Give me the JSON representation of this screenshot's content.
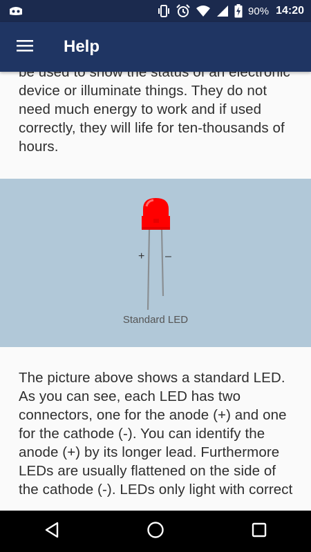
{
  "status_bar": {
    "battery_percent": "90%",
    "time": "14:20",
    "icons": [
      "android-debug-icon",
      "vibrate-icon",
      "alarm-icon",
      "wifi-icon",
      "signal-icon",
      "battery-charging-icon"
    ]
  },
  "app_bar": {
    "title": "Help",
    "menu_icon": "hamburger-menu-icon"
  },
  "content": {
    "paragraph_top": "be used to show the status of an electronic device or illuminate things. They do not need much energy to work and if used correctly, they will life for ten-thousands of hours.",
    "figure": {
      "plus_label": "+",
      "minus_label": "–",
      "caption": "Standard LED",
      "led_color": "#ff0000",
      "background_color": "#b1c8d8"
    },
    "paragraph_bottom": "The picture above shows a standard LED. As you can see, each LED has two connectors, one for the anode (+) and one for the cathode (-). You can identify the anode (+) by its longer lead. Furthermore LEDs are usually flattened on the side of the cathode (-). LEDs only light with correct"
  },
  "nav_bar": {
    "back_icon": "back-triangle-icon",
    "home_icon": "home-circle-icon",
    "recents_icon": "recents-square-icon"
  },
  "colors": {
    "status_bar": "#1b2a4e",
    "app_bar": "#1f3563",
    "text": "#2e2e2e",
    "nav_bar": "#000000"
  }
}
